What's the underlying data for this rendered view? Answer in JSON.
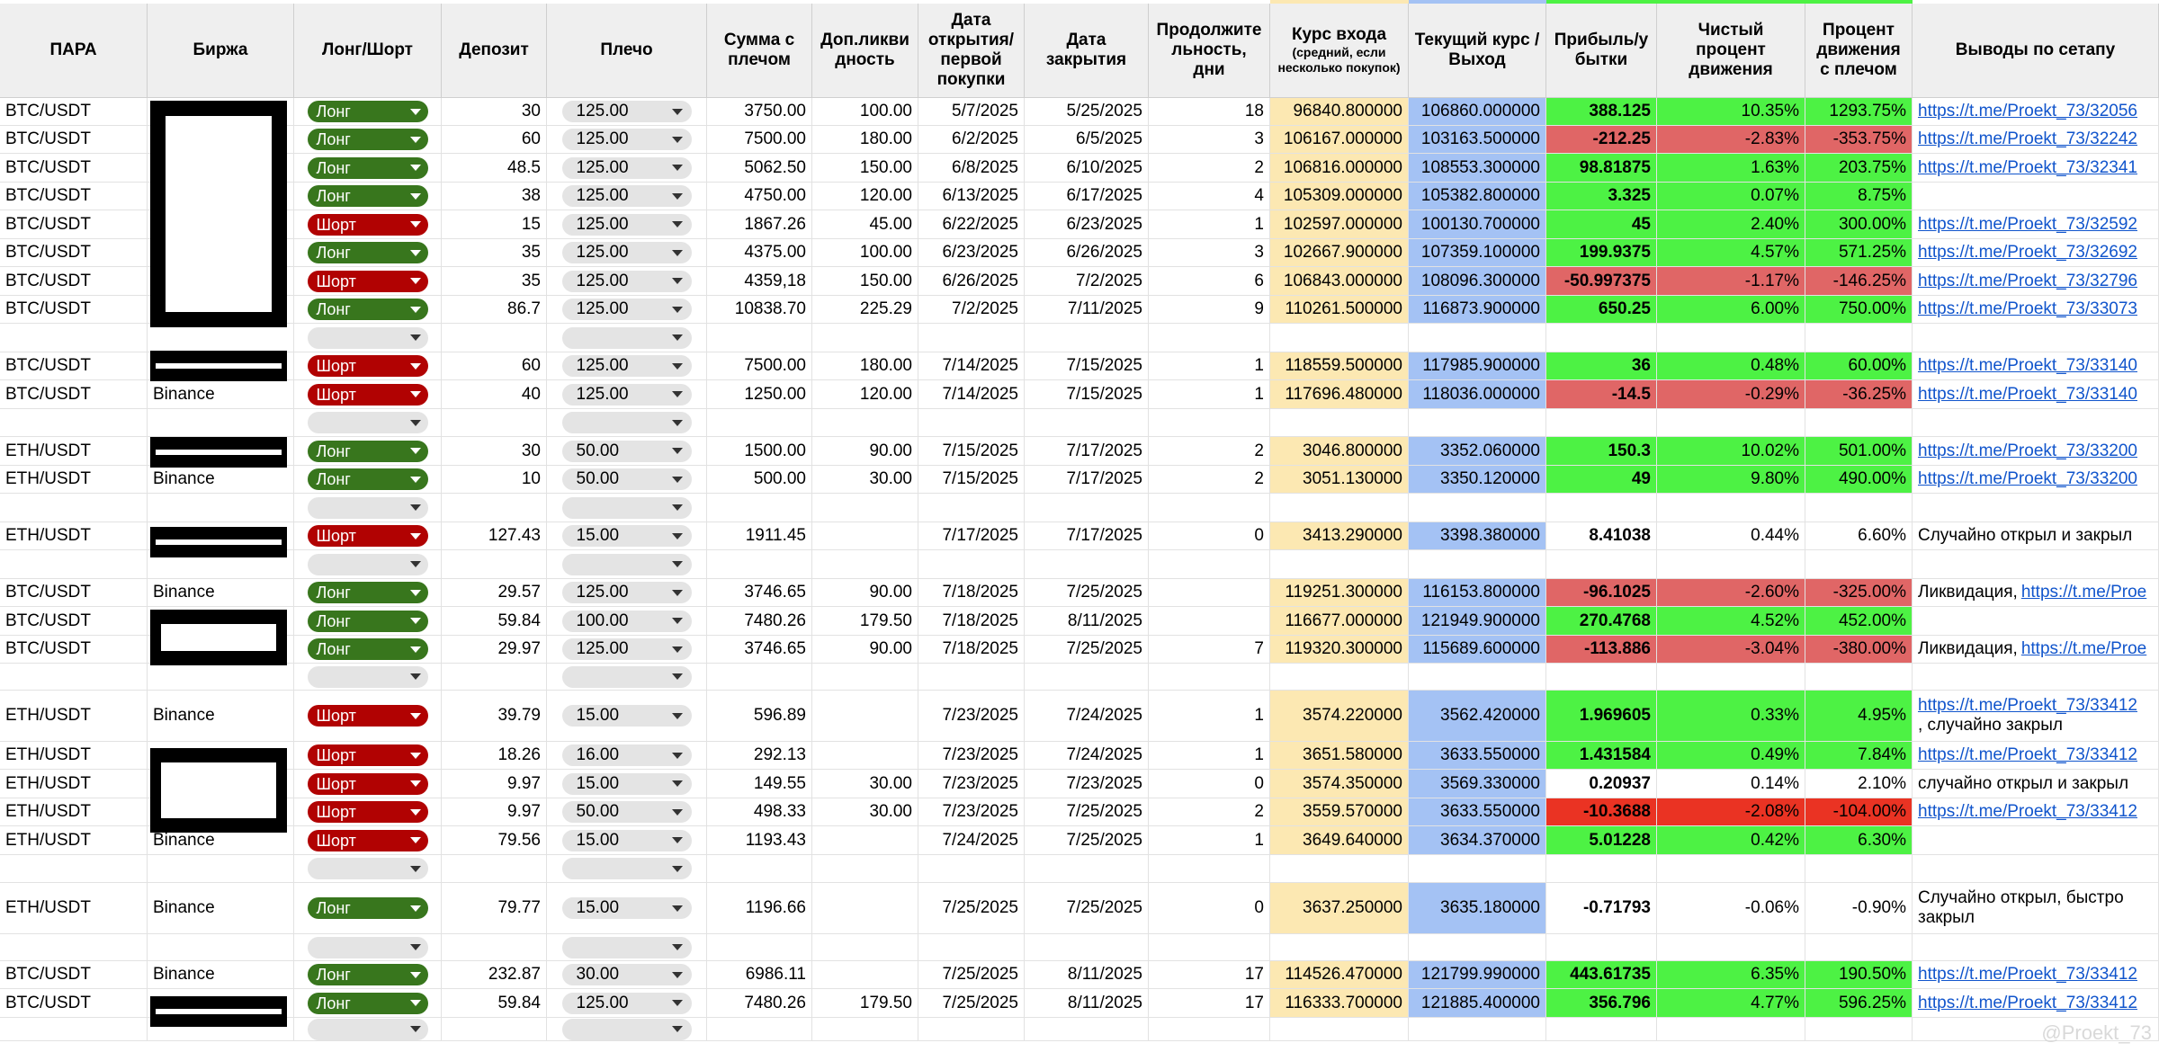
{
  "headers": [
    "ПАРА",
    "Биржа",
    "Лонг/Шорт",
    "Депозит",
    "Плечо",
    "Сумма с плечом",
    "Доп.ликви дность",
    "Дата открытия/ первой покупки",
    "Дата закрытия",
    "Продолжите льность, дни",
    "Курс входа",
    "(средний, если несколько покупок)",
    "Текущий курс / Выход",
    "Прибыль/у бытки",
    "Чистый процент движения",
    "Процент движения с плечом",
    "Выводы по сетапу"
  ],
  "colors": {
    "long": "#38761d",
    "short": "#b10202",
    "entry_bg": "#fce8b2",
    "exit_bg": "#a4c2f4",
    "profit_bg": "#4df244",
    "loss_bg": "#e06666",
    "big_loss_bg": "#ea3323",
    "link": "#1155cc"
  },
  "rows": [
    {
      "pair": "BTC/USDT",
      "exchange": "",
      "side": "Лонг",
      "deposit": "30",
      "lev": "125.00",
      "sum": "3750.00",
      "liq": "100.00",
      "open": "5/7/2025",
      "close": "5/25/2025",
      "days": "18",
      "entry": "96840.800000",
      "exit": "106860.000000",
      "pnl": "388.125",
      "pct": "10.35%",
      "pctlev": "1293.75%",
      "note": "https://t.me/Proekt_73/32056"
    },
    {
      "pair": "BTC/USDT",
      "exchange": "",
      "side": "Лонг",
      "deposit": "60",
      "lev": "125.00",
      "sum": "7500.00",
      "liq": "180.00",
      "open": "6/2/2025",
      "close": "6/5/2025",
      "days": "3",
      "entry": "106167.000000",
      "exit": "103163.500000",
      "pnl": "-212.25",
      "pct": "-2.83%",
      "pctlev": "-353.75%",
      "note": "https://t.me/Proekt_73/32242"
    },
    {
      "pair": "BTC/USDT",
      "exchange": "",
      "side": "Лонг",
      "deposit": "48.5",
      "lev": "125.00",
      "sum": "5062.50",
      "liq": "150.00",
      "open": "6/8/2025",
      "close": "6/10/2025",
      "days": "2",
      "entry": "106816.000000",
      "exit": "108553.300000",
      "pnl": "98.81875",
      "pct": "1.63%",
      "pctlev": "203.75%",
      "note": "https://t.me/Proekt_73/32341"
    },
    {
      "pair": "BTC/USDT",
      "exchange": "",
      "side": "Лонг",
      "deposit": "38",
      "lev": "125.00",
      "sum": "4750.00",
      "liq": "120.00",
      "open": "6/13/2025",
      "close": "6/17/2025",
      "days": "4",
      "entry": "105309.000000",
      "exit": "105382.800000",
      "pnl": "3.325",
      "pct": "0.07%",
      "pctlev": "8.75%",
      "note": ""
    },
    {
      "pair": "BTC/USDT",
      "exchange": "",
      "side": "Шорт",
      "deposit": "15",
      "lev": "125.00",
      "sum": "1867.26",
      "liq": "45.00",
      "open": "6/22/2025",
      "close": "6/23/2025",
      "days": "1",
      "entry": "102597.000000",
      "exit": "100130.700000",
      "pnl": "45",
      "pct": "2.40%",
      "pctlev": "300.00%",
      "note": "https://t.me/Proekt_73/32592"
    },
    {
      "pair": "BTC/USDT",
      "exchange": "",
      "side": "Лонг",
      "deposit": "35",
      "lev": "125.00",
      "sum": "4375.00",
      "liq": "100.00",
      "open": "6/23/2025",
      "close": "6/26/2025",
      "days": "3",
      "entry": "102667.900000",
      "exit": "107359.100000",
      "pnl": "199.9375",
      "pct": "4.57%",
      "pctlev": "571.25%",
      "note": "https://t.me/Proekt_73/32692"
    },
    {
      "pair": "BTC/USDT",
      "exchange": "",
      "side": "Шорт",
      "deposit": "35",
      "lev": "125.00",
      "sum": "4359,18",
      "liq": "150.00",
      "open": "6/26/2025",
      "close": "7/2/2025",
      "days": "6",
      "entry": "106843.000000",
      "exit": "108096.300000",
      "pnl": "-50.997375",
      "pct": "-1.17%",
      "pctlev": "-146.25%",
      "note": "https://t.me/Proekt_73/32796"
    },
    {
      "pair": "BTC/USDT",
      "exchange": "",
      "side": "Лонг",
      "deposit": "86.7",
      "lev": "125.00",
      "sum": "10838.70",
      "liq": "225.29",
      "open": "7/2/2025",
      "close": "7/11/2025",
      "days": "9",
      "entry": "110261.500000",
      "exit": "116873.900000",
      "pnl": "650.25",
      "pct": "6.00%",
      "pctlev": "750.00%",
      "note": "https://t.me/Proekt_73/33073"
    },
    {
      "pair": "",
      "exchange": "",
      "side": "",
      "deposit": "",
      "lev": "",
      "sum": "",
      "liq": "",
      "open": "",
      "close": "",
      "days": "",
      "entry": "",
      "exit": "",
      "pnl": "",
      "pct": "",
      "pctlev": "",
      "note": ""
    },
    {
      "pair": "BTC/USDT",
      "exchange": "",
      "side": "Шорт",
      "deposit": "60",
      "lev": "125.00",
      "sum": "7500.00",
      "liq": "180.00",
      "open": "7/14/2025",
      "close": "7/15/2025",
      "days": "1",
      "entry": "118559.500000",
      "exit": "117985.900000",
      "pnl": "36",
      "pct": "0.48%",
      "pctlev": "60.00%",
      "note": "https://t.me/Proekt_73/33140"
    },
    {
      "pair": "BTC/USDT",
      "exchange": "Binance",
      "side": "Шорт",
      "deposit": "40",
      "lev": "125.00",
      "sum": "1250.00",
      "liq": "120.00",
      "open": "7/14/2025",
      "close": "7/15/2025",
      "days": "1",
      "entry": "117696.480000",
      "exit": "118036.000000",
      "pnl": "-14.5",
      "pct": "-0.29%",
      "pctlev": "-36.25%",
      "note": "https://t.me/Proekt_73/33140"
    },
    {
      "pair": "",
      "exchange": "",
      "side": "",
      "deposit": "",
      "lev": "",
      "sum": "",
      "liq": "",
      "open": "",
      "close": "",
      "days": "",
      "entry": "",
      "exit": "",
      "pnl": "",
      "pct": "",
      "pctlev": "",
      "note": ""
    },
    {
      "pair": "ETH/USDT",
      "exchange": "",
      "side": "Лонг",
      "deposit": "30",
      "lev": "50.00",
      "sum": "1500.00",
      "liq": "90.00",
      "open": "7/15/2025",
      "close": "7/17/2025",
      "days": "2",
      "entry": "3046.800000",
      "exit": "3352.060000",
      "pnl": "150.3",
      "pct": "10.02%",
      "pctlev": "501.00%",
      "note": "https://t.me/Proekt_73/33200"
    },
    {
      "pair": "ETH/USDT",
      "exchange": "Binance",
      "side": "Лонг",
      "deposit": "10",
      "lev": "50.00",
      "sum": "500.00",
      "liq": "30.00",
      "open": "7/15/2025",
      "close": "7/17/2025",
      "days": "2",
      "entry": "3051.130000",
      "exit": "3350.120000",
      "pnl": "49",
      "pct": "9.80%",
      "pctlev": "490.00%",
      "note": "https://t.me/Proekt_73/33200"
    },
    {
      "pair": "",
      "exchange": "",
      "side": "",
      "deposit": "",
      "lev": "",
      "sum": "",
      "liq": "",
      "open": "",
      "close": "",
      "days": "",
      "entry": "",
      "exit": "",
      "pnl": "",
      "pct": "",
      "pctlev": "",
      "note": ""
    },
    {
      "pair": "ETH/USDT",
      "exchange": "",
      "side": "Шорт",
      "deposit": "127.43",
      "lev": "15.00",
      "sum": "1911.45",
      "liq": "",
      "open": "7/17/2025",
      "close": "7/17/2025",
      "days": "0",
      "entry": "3413.290000",
      "exit": "3398.380000",
      "pnl": "8.41038",
      "pct": "0.44%",
      "pctlev": "6.60%",
      "note": "Случайно открыл и закрыл"
    },
    {
      "pair": "",
      "exchange": "",
      "side": "",
      "deposit": "",
      "lev": "",
      "sum": "",
      "liq": "",
      "open": "",
      "close": "",
      "days": "",
      "entry": "",
      "exit": "",
      "pnl": "",
      "pct": "",
      "pctlev": "",
      "note": ""
    },
    {
      "pair": "BTC/USDT",
      "exchange": "Binance",
      "side": "Лонг",
      "deposit": "29.57",
      "lev": "125.00",
      "sum": "3746.65",
      "liq": "90.00",
      "open": "7/18/2025",
      "close": "7/25/2025",
      "days": "",
      "entry": "119251.300000",
      "exit": "116153.800000",
      "pnl": "-96.1025",
      "pct": "-2.60%",
      "pctlev": "-325.00%",
      "note": "Ликвидация, ",
      "note_link": "https://t.me/Proe"
    },
    {
      "pair": "BTC/USDT",
      "exchange": "",
      "side": "Лонг",
      "deposit": "59.84",
      "lev": "100.00",
      "sum": "7480.26",
      "liq": "179.50",
      "open": "7/18/2025",
      "close": "8/11/2025",
      "days": "",
      "entry": "116677.000000",
      "exit": "121949.900000",
      "pnl": "270.4768",
      "pct": "4.52%",
      "pctlev": "452.00%",
      "note": ""
    },
    {
      "pair": "BTC/USDT",
      "exchange": "",
      "side": "Лонг",
      "deposit": "29.97",
      "lev": "125.00",
      "sum": "3746.65",
      "liq": "90.00",
      "open": "7/18/2025",
      "close": "7/25/2025",
      "days": "7",
      "entry": "119320.300000",
      "exit": "115689.600000",
      "pnl": "-113.886",
      "pct": "-3.04%",
      "pctlev": "-380.00%",
      "note": "Ликвидация, ",
      "note_link": "https://t.me/Proe"
    },
    {
      "pair": "",
      "exchange": "",
      "side": "",
      "deposit": "",
      "lev": "",
      "sum": "",
      "liq": "",
      "open": "",
      "close": "",
      "days": "",
      "entry": "",
      "exit": "",
      "pnl": "",
      "pct": "",
      "pctlev": "",
      "note": ""
    },
    {
      "pair": "ETH/USDT",
      "exchange": "Binance",
      "side": "Шорт",
      "deposit": "39.79",
      "lev": "15.00",
      "sum": "596.89",
      "liq": "",
      "open": "7/23/2025",
      "close": "7/24/2025",
      "days": "1",
      "entry": "3574.220000",
      "exit": "3562.420000",
      "pnl": "1.969605",
      "pct": "0.33%",
      "pctlev": "4.95%",
      "note": ", случайно закрыл",
      "note_link": "https://t.me/Proekt_73/33412"
    },
    {
      "pair": "ETH/USDT",
      "exchange": "",
      "side": "Шорт",
      "deposit": "18.26",
      "lev": "16.00",
      "sum": "292.13",
      "liq": "",
      "open": "7/23/2025",
      "close": "7/24/2025",
      "days": "1",
      "entry": "3651.580000",
      "exit": "3633.550000",
      "pnl": "1.431584",
      "pct": "0.49%",
      "pctlev": "7.84%",
      "note": "https://t.me/Proekt_73/33412"
    },
    {
      "pair": "ETH/USDT",
      "exchange": "",
      "side": "Шорт",
      "deposit": "9.97",
      "lev": "15.00",
      "sum": "149.55",
      "liq": "30.00",
      "open": "7/23/2025",
      "close": "7/23/2025",
      "days": "0",
      "entry": "3574.350000",
      "exit": "3569.330000",
      "pnl": "0.20937",
      "pct": "0.14%",
      "pctlev": "2.10%",
      "note": "случайно открыл и закрыл"
    },
    {
      "pair": "ETH/USDT",
      "exchange": "",
      "side": "Шорт",
      "deposit": "9.97",
      "lev": "50.00",
      "sum": "498.33",
      "liq": "30.00",
      "open": "7/23/2025",
      "close": "7/25/2025",
      "days": "2",
      "entry": "3559.570000",
      "exit": "3633.550000",
      "pnl": "-10.3688",
      "pct": "-2.08%",
      "pctlev": "-104.00%",
      "note": "https://t.me/Proekt_73/33412"
    },
    {
      "pair": "ETH/USDT",
      "exchange": "Binance",
      "side": "Шорт",
      "deposit": "79.56",
      "lev": "15.00",
      "sum": "1193.43",
      "liq": "",
      "open": "7/24/2025",
      "close": "7/25/2025",
      "days": "1",
      "entry": "3649.640000",
      "exit": "3634.370000",
      "pnl": "5.01228",
      "pct": "0.42%",
      "pctlev": "6.30%",
      "note": ""
    },
    {
      "pair": "",
      "exchange": "",
      "side": "",
      "deposit": "",
      "lev": "",
      "sum": "",
      "liq": "",
      "open": "",
      "close": "",
      "days": "",
      "entry": "",
      "exit": "",
      "pnl": "",
      "pct": "",
      "pctlev": "",
      "note": ""
    },
    {
      "pair": "ETH/USDT",
      "exchange": "Binance",
      "side": "Лонг",
      "deposit": "79.77",
      "lev": "15.00",
      "sum": "1196.66",
      "liq": "",
      "open": "7/25/2025",
      "close": "7/25/2025",
      "days": "0",
      "entry": "3637.250000",
      "exit": "3635.180000",
      "pnl": "-0.71793",
      "pct": "-0.06%",
      "pctlev": "-0.90%",
      "note": "Случайно открыл, быстро закрыл"
    },
    {
      "pair": "",
      "exchange": "",
      "side": "",
      "deposit": "",
      "lev": "",
      "sum": "",
      "liq": "",
      "open": "",
      "close": "",
      "days": "",
      "entry": "",
      "exit": "",
      "pnl": "",
      "pct": "",
      "pctlev": "",
      "note": ""
    },
    {
      "pair": "BTC/USDT",
      "exchange": "Binance",
      "side": "Лонг",
      "deposit": "232.87",
      "lev": "30.00",
      "sum": "6986.11",
      "liq": "",
      "open": "7/25/2025",
      "close": "8/11/2025",
      "days": "17",
      "entry": "114526.470000",
      "exit": "121799.990000",
      "pnl": "443.61735",
      "pct": "6.35%",
      "pctlev": "190.50%",
      "note": "https://t.me/Proekt_73/33412"
    },
    {
      "pair": "BTC/USDT",
      "exchange": "",
      "side": "Лонг",
      "deposit": "59.84",
      "lev": "125.00",
      "sum": "7480.26",
      "liq": "179.50",
      "open": "7/25/2025",
      "close": "8/11/2025",
      "days": "17",
      "entry": "116333.700000",
      "exit": "121885.400000",
      "pnl": "356.796",
      "pct": "4.77%",
      "pctlev": "596.25%",
      "note": "https://t.me/Proekt_73/33412"
    },
    {
      "pair": "",
      "exchange": "",
      "side": "",
      "deposit": "",
      "lev": "",
      "sum": "",
      "liq": "",
      "open": "",
      "close": "",
      "days": "",
      "entry": "",
      "exit": "",
      "pnl": "",
      "pct": "",
      "pctlev": "",
      "note": ""
    }
  ],
  "watermark": "@Proekt_73"
}
